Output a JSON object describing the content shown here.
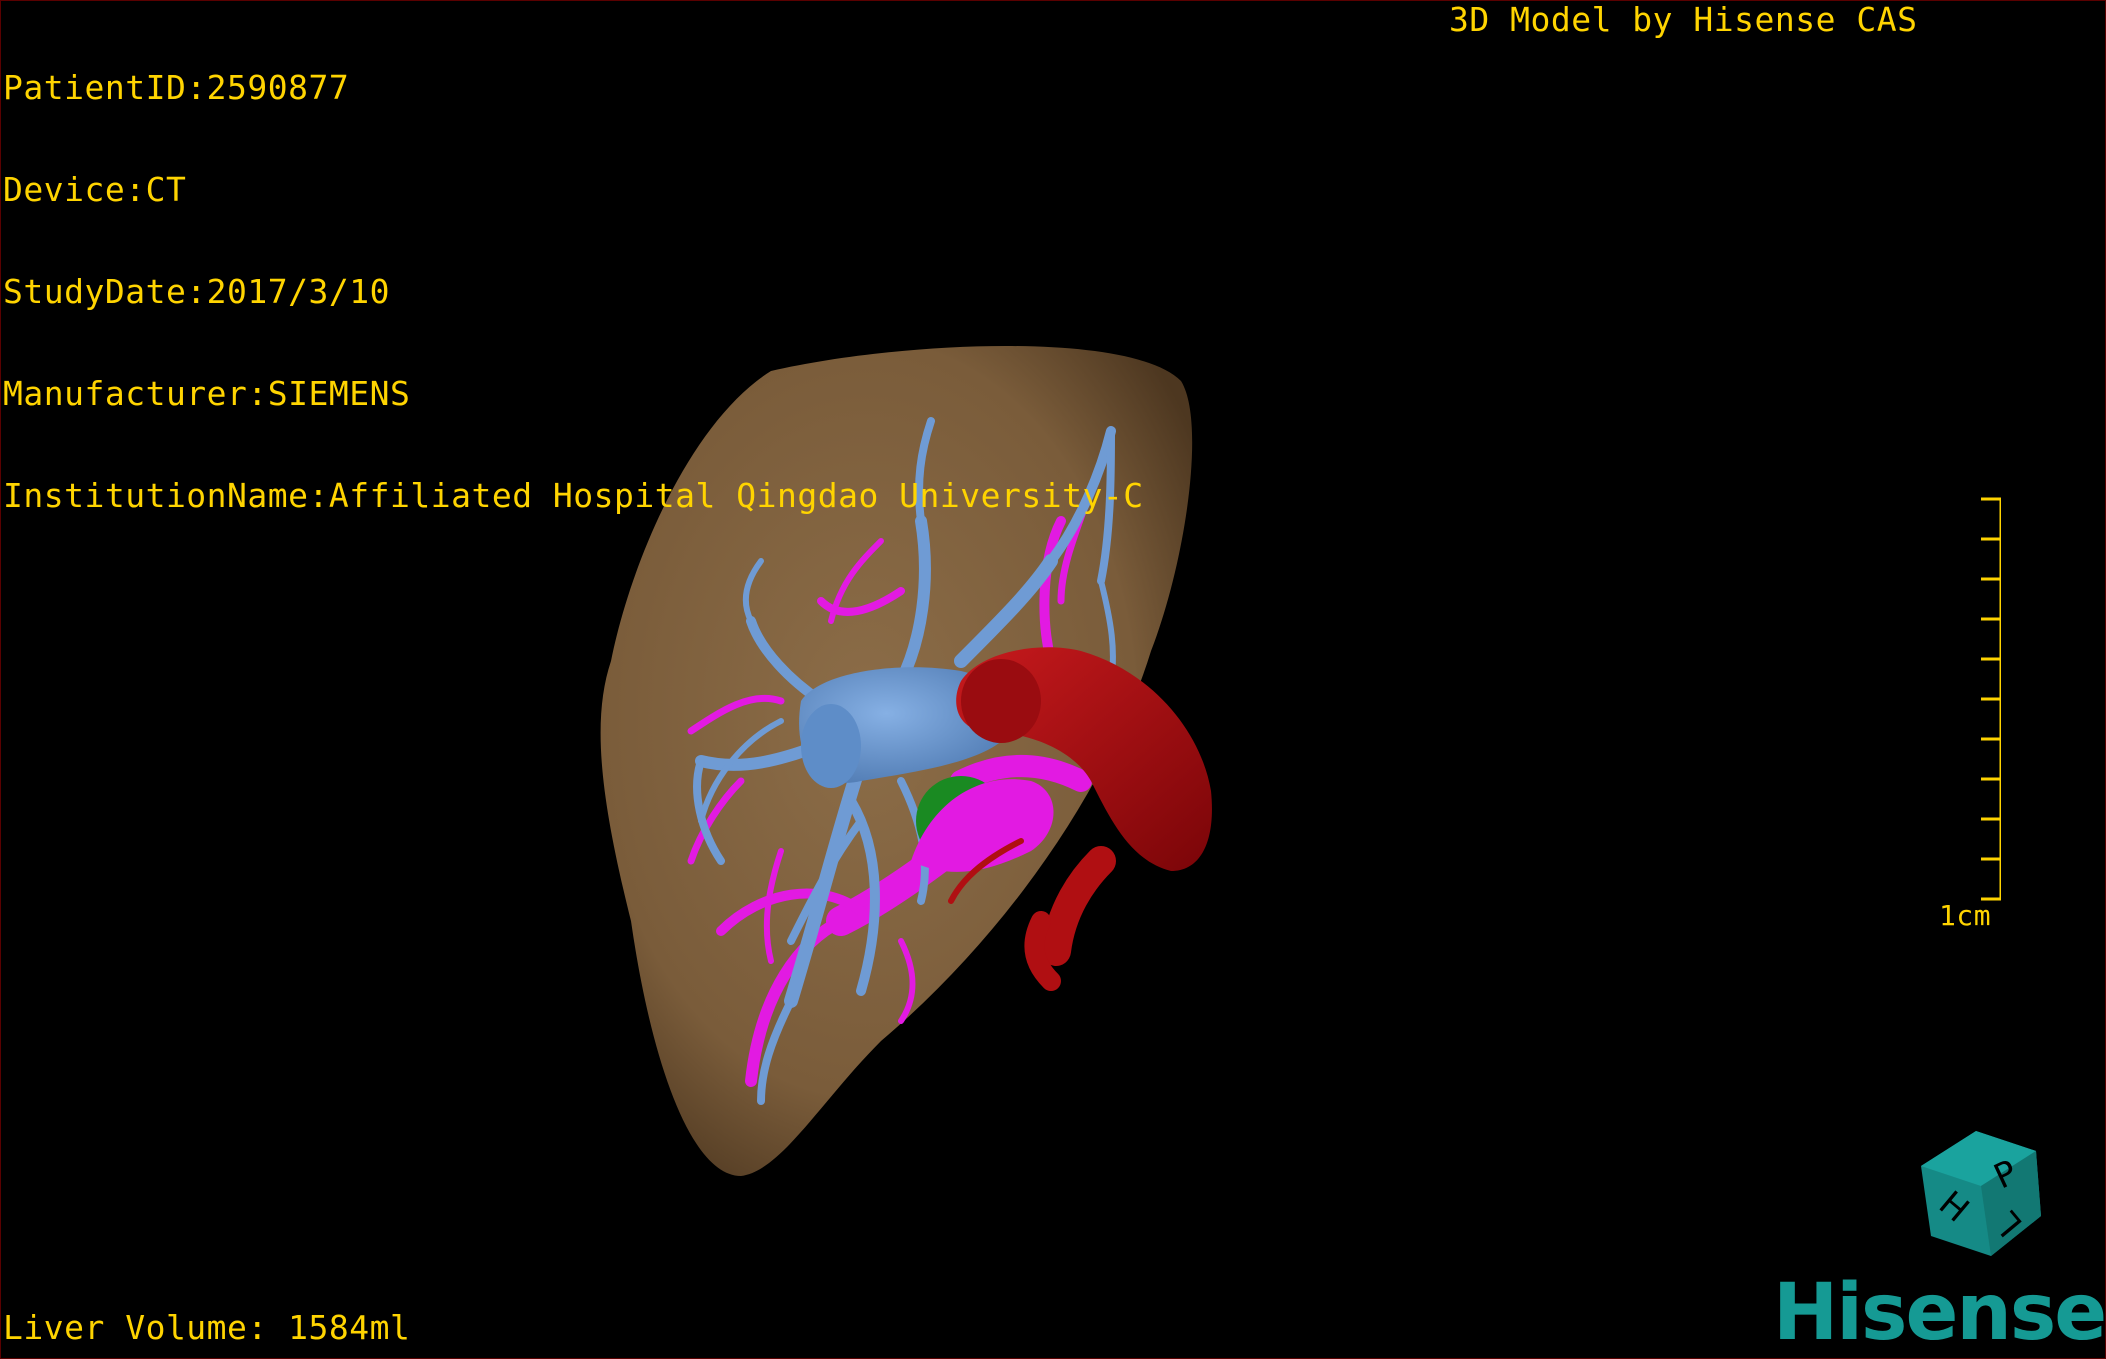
{
  "dicom_info": {
    "patient_id": "PatientID:2590877",
    "device": "Device:CT",
    "study_date": "StudyDate:2017/3/10",
    "manufacturer": "Manufacturer:SIEMENS",
    "institution": "InstitutionName:Affiliated Hospital Qingdao University-C"
  },
  "watermark": {
    "title": "3D Model by Hisense CAS",
    "logo": "Hisense"
  },
  "measurements": {
    "liver_volume": "Liver Volume: 1584ml"
  },
  "scale_bar": {
    "label": "1cm",
    "ticks": 10
  },
  "orientation_cube": {
    "faces": [
      "P",
      "H",
      "L"
    ]
  },
  "structures": [
    {
      "name": "liver",
      "color": "#8b6a45"
    },
    {
      "name": "portal vein / hepatic vein branches",
      "color": "#6f9bd4"
    },
    {
      "name": "hepatic artery branches",
      "color": "#e21ae2"
    },
    {
      "name": "inferior vena cava",
      "color": "#b00f12"
    },
    {
      "name": "lesion",
      "color": "#1a8a22"
    }
  ],
  "colors": {
    "overlay_text": "#ffd400",
    "background": "#000000",
    "logo": "#159a94"
  }
}
